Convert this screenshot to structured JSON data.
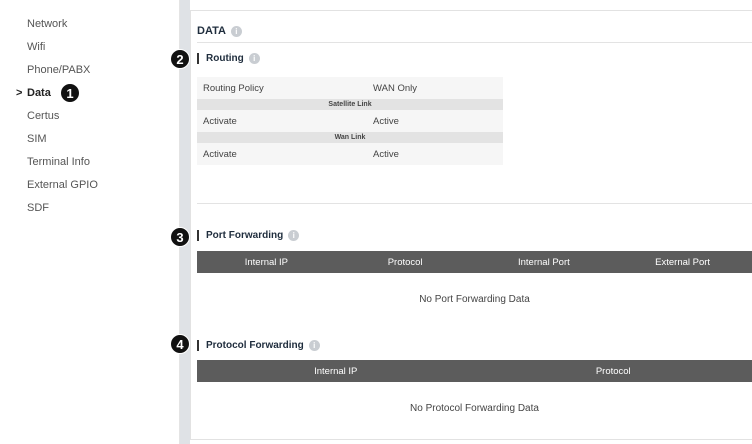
{
  "sidebar": {
    "items": [
      {
        "label": "Network"
      },
      {
        "label": "Wifi"
      },
      {
        "label": "Phone/PABX"
      },
      {
        "label": "Data",
        "active": true,
        "chevron": ">"
      },
      {
        "label": "Certus"
      },
      {
        "label": "SIM"
      },
      {
        "label": "Terminal Info"
      },
      {
        "label": "External GPIO"
      },
      {
        "label": "SDF"
      }
    ]
  },
  "main": {
    "title": "DATA",
    "routing": {
      "heading": "Routing",
      "policy_label": "Routing Policy",
      "policy_value": "WAN Only",
      "satellite_header": "Satellite Link",
      "satellite_activate_label": "Activate",
      "satellite_activate_value": "Active",
      "wan_header": "Wan Link",
      "wan_activate_label": "Activate",
      "wan_activate_value": "Active"
    },
    "port_forwarding": {
      "heading": "Port Forwarding",
      "columns": [
        "Internal IP",
        "Protocol",
        "Internal Port",
        "External Port"
      ],
      "empty_text": "No Port Forwarding Data"
    },
    "protocol_forwarding": {
      "heading": "Protocol Forwarding",
      "columns": [
        "Internal IP",
        "Protocol"
      ],
      "empty_text": "No Protocol Forwarding Data"
    }
  },
  "callouts": [
    "1",
    "2",
    "3",
    "4"
  ],
  "colors": {
    "table_header": "#5c5c5c",
    "gutter": "#dfe2e6",
    "badge": "#111111"
  }
}
